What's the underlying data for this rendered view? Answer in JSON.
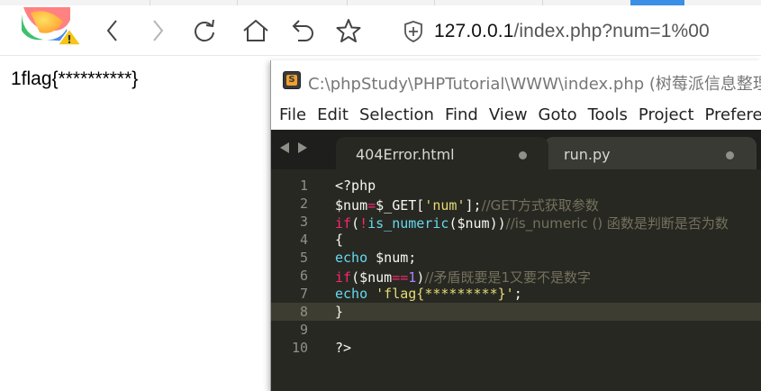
{
  "browser": {
    "url_host": "127.0.0.1",
    "url_path": "/index.php?num=1%00",
    "nav_icons": [
      "back-icon",
      "forward-icon",
      "reload-icon",
      "home-icon",
      "undo-icon",
      "star-icon"
    ],
    "security_icon": "shield-icon"
  },
  "page": {
    "output_text": "1flag{**********}"
  },
  "editor_window": {
    "title": "C:\\phpStudy\\PHPTutorial\\WWW\\index.php (树莓派信息整理",
    "menu": [
      "File",
      "Edit",
      "Selection",
      "Find",
      "View",
      "Goto",
      "Tools",
      "Project",
      "Prefere"
    ],
    "tabs": [
      {
        "label": "404Error.html",
        "active": true
      },
      {
        "label": "run.py",
        "active": false
      }
    ],
    "active_line": 8,
    "line_numbers": [
      "1",
      "2",
      "3",
      "4",
      "5",
      "6",
      "7",
      "8",
      "9",
      "10"
    ],
    "code": {
      "l1": "<?php",
      "l2_var": "$num",
      "l2_op": "=",
      "l2_get": "$_GET[",
      "l2_key": "'num'",
      "l2_end": "];",
      "l2_comment": "//GET方式获取参数",
      "l3_if": "if",
      "l3_open": "(",
      "l3_not": "!",
      "l3_fn": "is_numeric",
      "l3_args": "($num))",
      "l3_comment": "//is_numeric () 函数是判断是否为数",
      "l4": "{",
      "l5_echo": "echo",
      "l5_rest": " $num;",
      "l6_if": "if",
      "l6_open": "($num",
      "l6_op": "==",
      "l6_num": "1",
      "l6_close": ")",
      "l6_comment": "//矛盾既要是1又要不是数字",
      "l7_echo": "echo",
      "l7_str": "'flag{*********}'",
      "l7_end": ";",
      "l8": "}",
      "l9": "",
      "l10": "?>"
    }
  },
  "colors": {
    "editor_bg": "#272822",
    "keyword": "#f92672",
    "function": "#66d9ef",
    "string": "#e6db74",
    "number": "#ae81ff",
    "comment": "#75715e"
  }
}
